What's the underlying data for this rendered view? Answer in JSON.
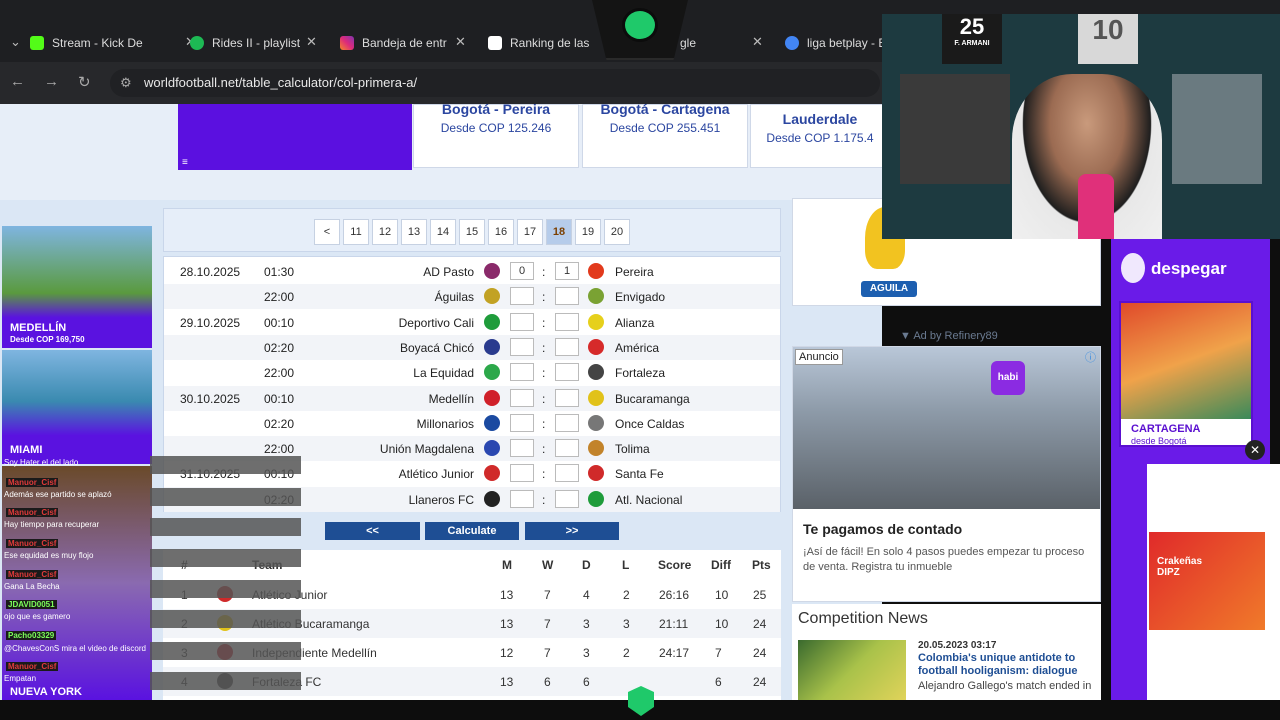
{
  "browser": {
    "tabs": [
      {
        "label": "Stream - Kick De",
        "icon_color": "#53fc18"
      },
      {
        "label": "Rides II - playlist",
        "icon_color": "#1db954"
      },
      {
        "label": "Bandeja de entr",
        "icon_color": "#e1306c"
      },
      {
        "label": "Ranking de las n",
        "icon_color": "#ffffff"
      },
      {
        "label": "gle",
        "icon_color": "#1e1f22"
      },
      {
        "label": "liga betplay - B",
        "icon_color": "#4285f4"
      }
    ],
    "url": "worldfootball.net/table_calculator/col-primera-a/"
  },
  "top_offers": [
    {
      "destination": "Bogotá - Pereira",
      "price": "Desde COP 125.246"
    },
    {
      "destination": "Bogotá - Cartagena",
      "price": "Desde COP 255.451"
    },
    {
      "destination": "Lauderdale",
      "price": "Desde COP 1.175.4"
    }
  ],
  "pager": {
    "prev": "<",
    "pages": [
      "11",
      "12",
      "13",
      "14",
      "15",
      "16",
      "17",
      "18",
      "19",
      "20"
    ],
    "active": "18"
  },
  "matches": [
    {
      "date": "28.10.2025",
      "time": "01:30",
      "home": "AD Pasto",
      "away": "Pereira",
      "hs": "0",
      "as": "1",
      "hc": "#8a2a6a",
      "ac": "#e23a1c"
    },
    {
      "date": "",
      "time": "22:00",
      "home": "Águilas",
      "away": "Envigado",
      "hs": "",
      "as": "",
      "hc": "#c2a224",
      "ac": "#7aa233"
    },
    {
      "date": "29.10.2025",
      "time": "00:10",
      "home": "Deportivo Cali",
      "away": "Alianza",
      "hs": "",
      "as": "",
      "hc": "#1f9c3b",
      "ac": "#e6d01c"
    },
    {
      "date": "",
      "time": "02:20",
      "home": "Boyacá Chicó",
      "away": "América",
      "hs": "",
      "as": "",
      "hc": "#2a3b8e",
      "ac": "#d62a2a"
    },
    {
      "date": "",
      "time": "22:00",
      "home": "La Equidad",
      "away": "Fortaleza",
      "hs": "",
      "as": "",
      "hc": "#2ca84a",
      "ac": "#444"
    },
    {
      "date": "30.10.2025",
      "time": "00:10",
      "home": "Medellín",
      "away": "Bucaramanga",
      "hs": "",
      "as": "",
      "hc": "#d0202a",
      "ac": "#e1c21a"
    },
    {
      "date": "",
      "time": "02:20",
      "home": "Millonarios",
      "away": "Once Caldas",
      "hs": "",
      "as": "",
      "hc": "#1b4aa1",
      "ac": "#777"
    },
    {
      "date": "",
      "time": "22:00",
      "home": "Unión Magdalena",
      "away": "Tolima",
      "hs": "",
      "as": "",
      "hc": "#2a47b0",
      "ac": "#c2832a"
    },
    {
      "date": "31.10.2025",
      "time": "00:10",
      "home": "Atlético Junior",
      "away": "Santa Fe",
      "hs": "",
      "as": "",
      "hc": "#d02a2a",
      "ac": "#d02a2a"
    },
    {
      "date": "",
      "time": "02:20",
      "home": "Llaneros FC",
      "away": "Atl. Nacional",
      "hs": "",
      "as": "",
      "hc": "#222",
      "ac": "#1f9c3b"
    }
  ],
  "nav_buttons": {
    "prev": "<<",
    "calc": "Calculate",
    "next": ">>"
  },
  "standings": {
    "headers": {
      "pos": "#",
      "team": "Team",
      "m": "M",
      "w": "W",
      "d": "D",
      "l": "L",
      "score": "Score",
      "diff": "Diff",
      "pts": "Pts"
    },
    "rows": [
      {
        "pos": "1",
        "team": "Atlético Junior",
        "m": "13",
        "w": "7",
        "d": "4",
        "l": "2",
        "score": "26:16",
        "diff": "10",
        "pts": "25",
        "c": "#d02a2a"
      },
      {
        "pos": "2",
        "team": "Atlético Bucaramanga",
        "m": "13",
        "w": "7",
        "d": "3",
        "l": "3",
        "score": "21:11",
        "diff": "10",
        "pts": "24",
        "c": "#e1c21a"
      },
      {
        "pos": "3",
        "team": "Independiente Medellín",
        "m": "12",
        "w": "7",
        "d": "3",
        "l": "2",
        "score": "24:17",
        "diff": "7",
        "pts": "24",
        "c": "#d0202a"
      },
      {
        "pos": "4",
        "team": "Fortaleza FC",
        "m": "13",
        "w": "6",
        "d": "6",
        "l": "",
        "score": "",
        "diff": "6",
        "pts": "24",
        "c": "#444"
      }
    ]
  },
  "right_ads": {
    "liga_logo": "AGUILA",
    "ad_by": "▼ Ad by Refinery89",
    "anuncio": "Anuncio",
    "habi": "habi",
    "headline": "Te pagamos de contado",
    "body": "¡Así de fácil! En solo 4 pasos puedes empezar tu proceso de venta. Registra tu inmueble"
  },
  "news": {
    "title": "Competition News",
    "date": "20.05.2023 03:17",
    "headline": "Colombia's unique antidote to football hooliganism: dialogue",
    "snippet": "Alejandro Gallego's match ended in"
  },
  "despegar": {
    "brand": "despegar",
    "dest": "CARTAGENA",
    "from": "desde Bogotá",
    "promo": "Crakeñas DIPZ"
  },
  "left_ads": [
    {
      "city": "MEDELLÍN",
      "price": "Desde COP 169,750"
    },
    {
      "city": "MIAMI",
      "price": ""
    },
    {
      "city": "NUEVA YORK",
      "price": ""
    }
  ],
  "chat": [
    {
      "user": "",
      "text": "Soy Hater el del lado"
    },
    {
      "user": "Manuor_Cisf",
      "text": "Además ese partido se aplazó"
    },
    {
      "user": "Manuor_Cisf",
      "text": "Hay tiempo para recuperar"
    },
    {
      "user": "Manuor_Cisf",
      "text": "Ese equidad es muy flojo"
    },
    {
      "user": "Manuor_Cisf",
      "text": "Gana La Becha"
    },
    {
      "user": "JDAVID0051",
      "text": "ojo que es gamero"
    },
    {
      "user": "Pacho03329",
      "text": "@ChavesConS mira el video de discord"
    },
    {
      "user": "Manuor_Cisf",
      "text": "Empatan"
    }
  ],
  "webcam": {
    "jersey_num1": "25",
    "jersey_name": "F. ARMANI",
    "jersey_num2": "10"
  }
}
